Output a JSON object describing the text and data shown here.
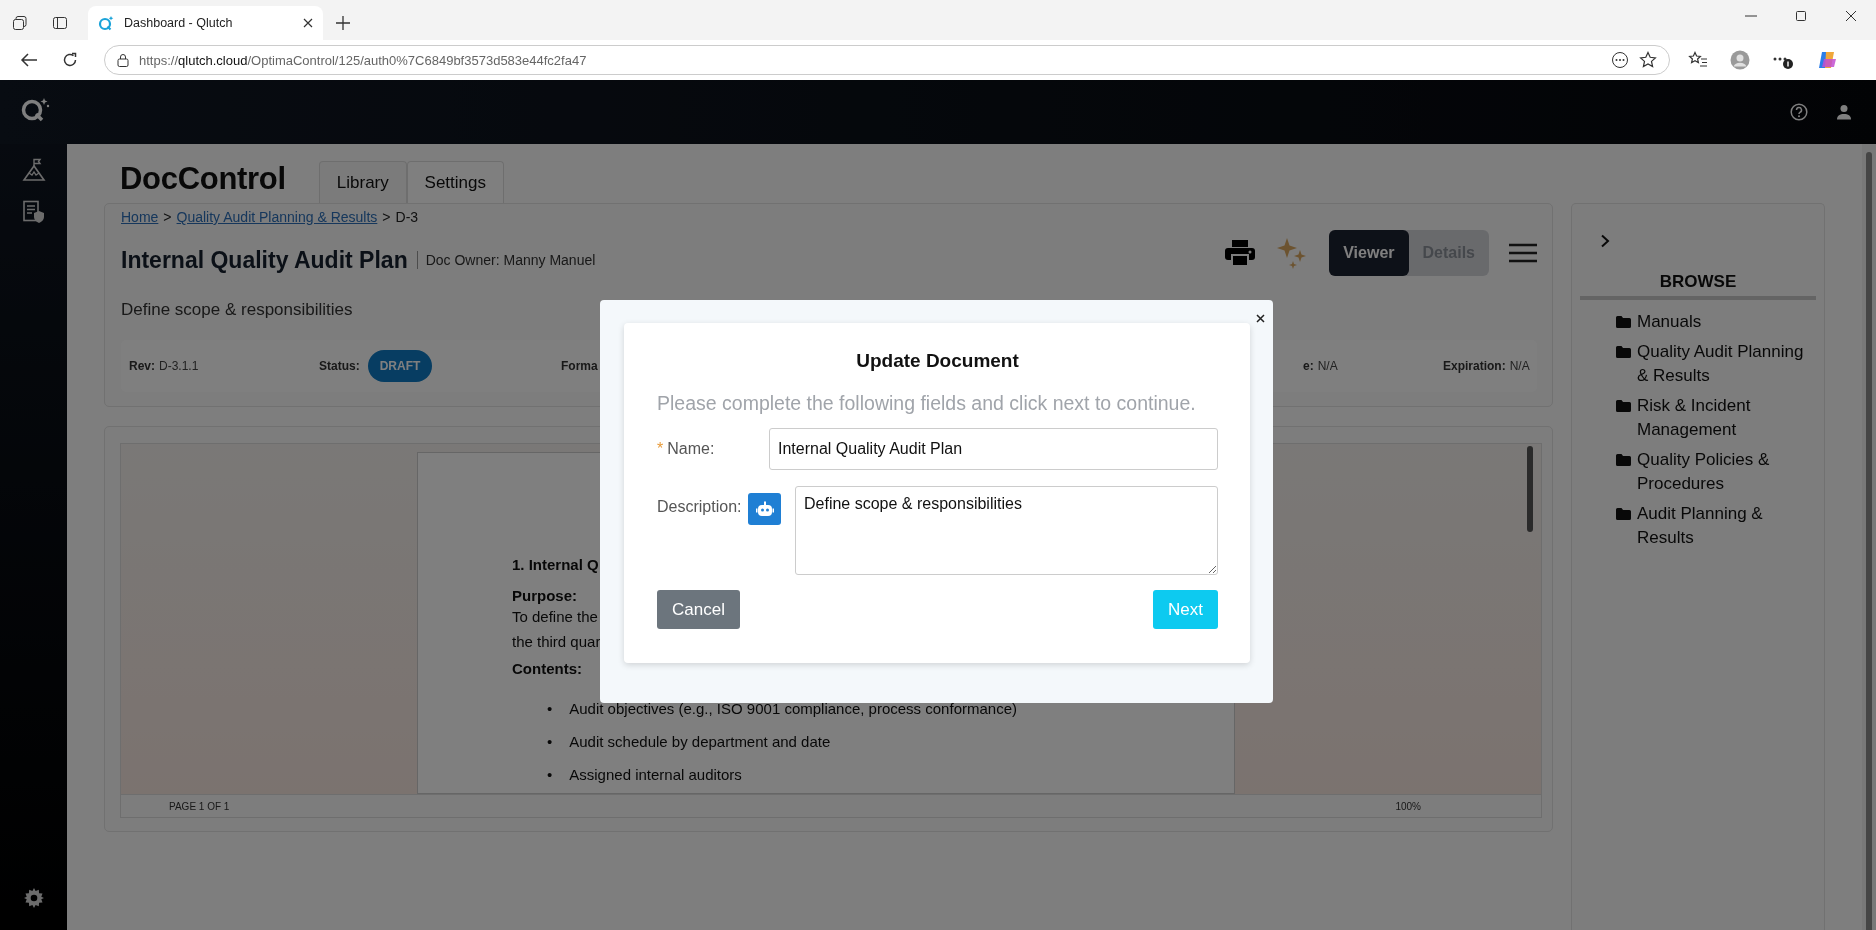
{
  "browser": {
    "tab_title": "Dashboard - Qlutch",
    "url_scheme": "https://",
    "url_host": "qlutch.cloud",
    "url_path": "/OptimaControl/125/auth0%7C6849bf3573d583e44fc2fa47"
  },
  "app": {
    "title": "DocControl",
    "tabs": [
      {
        "label": "Library",
        "selected": true
      },
      {
        "label": "Settings",
        "selected": false
      }
    ]
  },
  "breadcrumb": [
    {
      "kind": "link",
      "label": "Home"
    },
    {
      "kind": "separator",
      "label": ">"
    },
    {
      "kind": "link",
      "label": "Quality Audit Planning & Results"
    },
    {
      "kind": "separator",
      "label": ">"
    },
    {
      "kind": "current",
      "label": "D-3"
    }
  ],
  "document": {
    "title": "Internal Quality Audit Plan",
    "owner": "Doc Owner: Manny Manuel",
    "description": "Define scope & responsibilities"
  },
  "view_toggle": [
    {
      "label": "Viewer",
      "selected": true
    },
    {
      "label": "Details",
      "selected": false
    }
  ],
  "meta": [
    {
      "kind": "value",
      "label": "Rev:",
      "value": "D-3.1.1"
    },
    {
      "kind": "badge",
      "label": "Status:",
      "value": "DRAFT"
    },
    {
      "kind": "label",
      "label": "Forma"
    },
    {
      "kind": "value",
      "label": "e:",
      "value": "N/A"
    },
    {
      "kind": "value",
      "label": "Expiration:",
      "value": "N/A"
    }
  ],
  "viewer": {
    "heading": "1. Internal Q",
    "purpose_label": "Purpose:",
    "purpose_lines": [
      "To define the",
      "the third quar"
    ],
    "contents_label": "Contents:",
    "bullets": [
      {
        "marker": "•",
        "text": "Audit objectives (e.g., ISO 9001 compliance, process conformance)"
      },
      {
        "marker": "•",
        "text": "Audit schedule by department and date"
      },
      {
        "marker": "•",
        "text": "Assigned internal auditors"
      }
    ],
    "page_indicator": "PAGE 1 OF 1",
    "zoom": "100%"
  },
  "browse": {
    "title": "BROWSE",
    "folders": [
      "Manuals",
      "Quality Audit Planning & Results",
      "Risk & Incident Management",
      "Quality Policies & Procedures",
      "Audit Planning & Results"
    ]
  },
  "modal": {
    "title": "Update Document",
    "instructions": "Please complete the following fields and click next to continue.",
    "required_mark": "*",
    "name_label": "Name:",
    "name_value": "Internal Quality Audit Plan",
    "description_label": "Description:",
    "description_value": "Define scope & responsibilities",
    "cancel": "Cancel",
    "next": "Next"
  }
}
